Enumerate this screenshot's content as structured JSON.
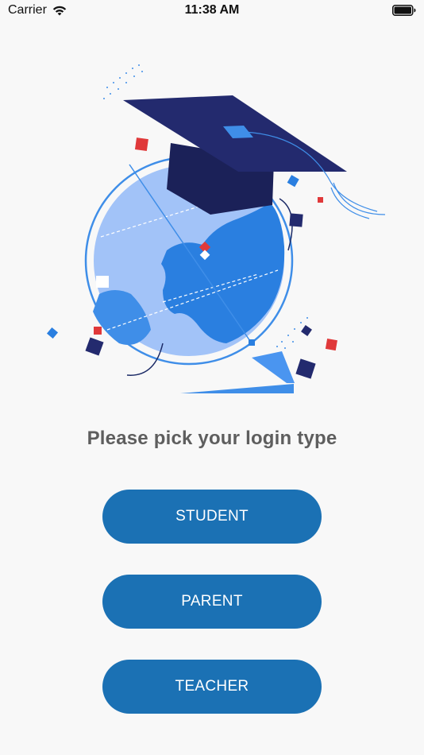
{
  "status_bar": {
    "carrier": "Carrier",
    "time": "11:38 AM"
  },
  "heading": "Please pick your login type",
  "buttons": {
    "student": "STUDENT",
    "parent": "PARENT",
    "teacher": "TEACHER"
  },
  "colors": {
    "button_bg": "#1b71b4",
    "heading_text": "#5e5e5e",
    "background": "#f8f8f8"
  },
  "icons": [
    "wifi-icon",
    "battery-icon",
    "globe-graduation-illustration"
  ]
}
